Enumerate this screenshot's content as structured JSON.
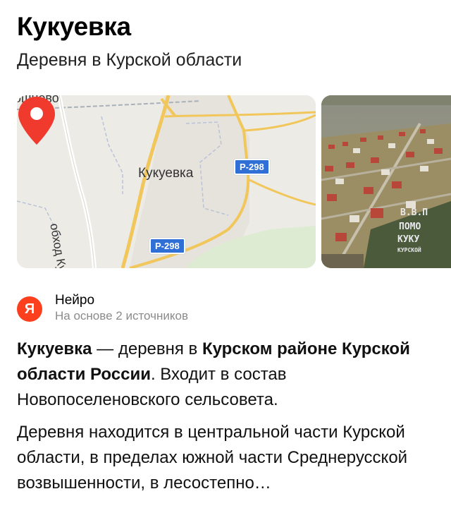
{
  "header": {
    "title": "Кукуевка",
    "subtitle": "Деревня в Курской области"
  },
  "map": {
    "place_label": "Кукуевка",
    "top_label": "ошнево",
    "road_label": "обход Курска",
    "route_1": "Р-298",
    "route_2": "Р-298"
  },
  "photo": {
    "sign_lines": [
      "В.В.П",
      "ПОМО",
      "КУКУ",
      "КУРСКОЙ"
    ]
  },
  "neuro": {
    "logo_letter": "Я",
    "name": "Нейро",
    "sources": "На основе 2 источников"
  },
  "answer": {
    "p1_bold_1": "Кукуевка",
    "p1_text_1": " — деревня в ",
    "p1_bold_2": "Курском районе Курской области России",
    "p1_text_2": ". Входит в состав Новопоселеновского сельсовета.",
    "p2": "Деревня находится в центральной части Курской области, в пределах южной части Среднерусской возвышенности, в лесостепно…"
  },
  "colors": {
    "brand": "#fc3f1d",
    "route_badge": "#2f6fd6",
    "road_yellow": "#f1c65a"
  }
}
